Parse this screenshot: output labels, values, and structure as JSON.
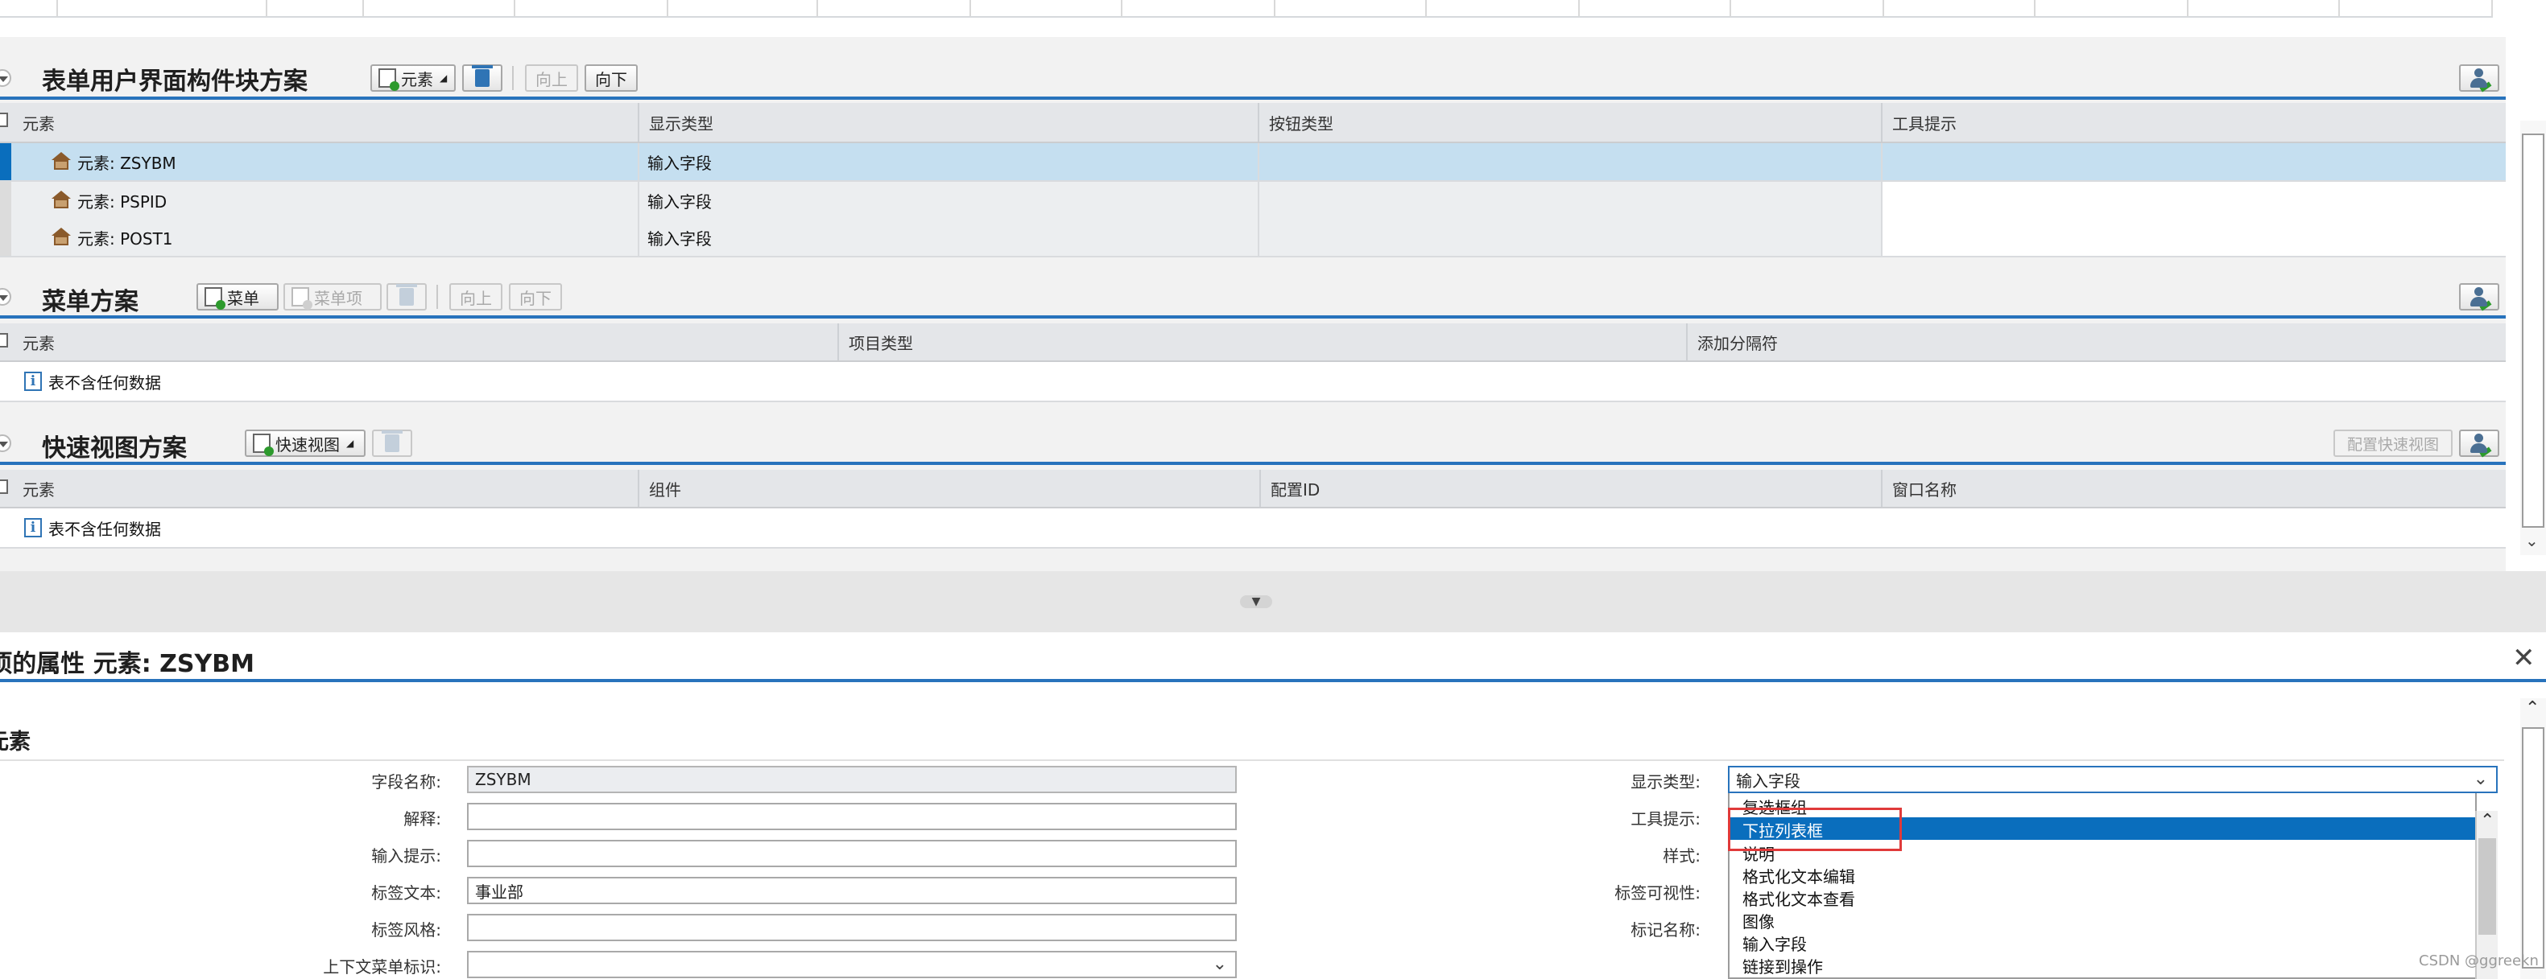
{
  "sections": {
    "ui_blocks": {
      "title": "表单用户界面构件块方案",
      "buttons": {
        "element": "元素",
        "up": "向上",
        "down": "向下"
      },
      "columns": [
        "元素",
        "显示类型",
        "按钮类型",
        "工具提示"
      ],
      "rows": [
        {
          "element": "元素: ZSYBM",
          "display": "输入字段",
          "button": "",
          "tooltip": ""
        },
        {
          "element": "元素: PSPID",
          "display": "输入字段",
          "button": "",
          "tooltip": ""
        },
        {
          "element": "元素: POST1",
          "display": "输入字段",
          "button": "",
          "tooltip": ""
        }
      ]
    },
    "menu": {
      "title": "菜单方案",
      "buttons": {
        "menu": "菜单",
        "menu_item": "菜单项",
        "up": "向上",
        "down": "向下"
      },
      "columns": [
        "元素",
        "项目类型",
        "添加分隔符"
      ],
      "empty": "表不含任何数据"
    },
    "quickview": {
      "title": "快速视图方案",
      "buttons": {
        "quickview": "快速视图",
        "config": "配置快速视图"
      },
      "columns": [
        "元素",
        "组件",
        "配置ID",
        "窗口名称"
      ],
      "empty": "表不含任何数据"
    }
  },
  "details": {
    "title": "项的属性 元素: ZSYBM",
    "subtitle": "元素",
    "left_fields": [
      {
        "label": "字段名称:",
        "value": "ZSYBM"
      },
      {
        "label": "解释:",
        "value": ""
      },
      {
        "label": "输入提示:",
        "value": ""
      },
      {
        "label": "标签文本:",
        "value": "事业部"
      },
      {
        "label": "标签风格:",
        "value": ""
      },
      {
        "label": "上下文菜单标识:",
        "value": ""
      }
    ],
    "right_labels": [
      "显示类型:",
      "工具提示:",
      "样式:",
      "标签可视性:",
      "标记名称:"
    ],
    "display_type_value": "输入字段",
    "dropdown_options": [
      "复选框组",
      "下拉列表框",
      "说明",
      "格式化文本编辑",
      "格式化文本查看",
      "图像",
      "输入字段",
      "链接到操作"
    ],
    "dropdown_selected": "下拉列表框"
  },
  "watermark": "CSDN @ggreekn",
  "colors": {
    "accent": "#2873bc",
    "highlight": "#c5dff0",
    "selection": "#0a6ebd",
    "callout": "#e03a3a"
  }
}
